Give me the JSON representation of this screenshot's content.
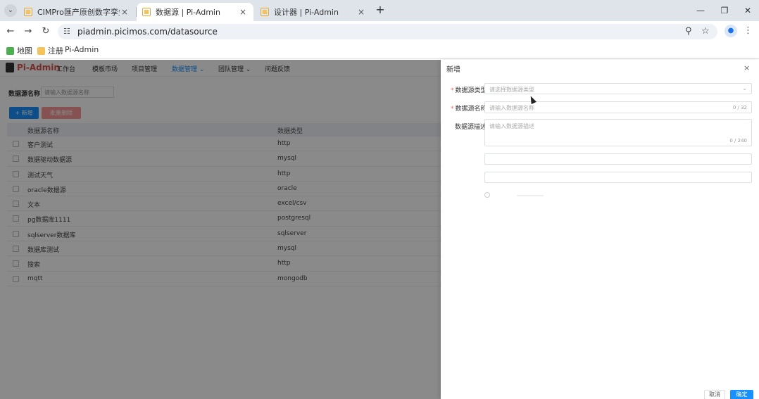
{
  "browser": {
    "tabs": [
      {
        "title": "CIMPro匯产原创数字孪生图形",
        "active": false
      },
      {
        "title": "数据源 | Pi-Admin",
        "active": true
      },
      {
        "title": "设计器 | Pi-Admin",
        "active": false
      }
    ],
    "new_tab": "+",
    "url": "piadmin.picimos.com/datasource",
    "bookmarks": [
      "地图",
      "注册",
      "Pi-Admin"
    ]
  },
  "app": {
    "logo": "Pi-Admin",
    "nav": [
      {
        "label": "工作台",
        "active": false
      },
      {
        "label": "模板市场",
        "active": false
      },
      {
        "label": "项目管理",
        "active": false
      },
      {
        "label": "数据管理 ⌄",
        "active": true
      },
      {
        "label": "团队管理 ⌄",
        "active": false
      },
      {
        "label": "问题反馈",
        "active": false
      }
    ],
    "search": {
      "label": "数据源名称",
      "placeholder": "请输入数据源名称"
    },
    "buttons": {
      "add": "+ 新增",
      "batch_delete": "批量删除"
    },
    "table": {
      "headers": [
        "数据源名称",
        "数据类型"
      ],
      "rows": [
        [
          "客户测试",
          "http"
        ],
        [
          "数据驱动数据源",
          "mysql"
        ],
        [
          "测试天气",
          "http"
        ],
        [
          "oracle数据源",
          "oracle"
        ],
        [
          "文本",
          "excel/csv"
        ],
        [
          "pg数据库1111",
          "postgresql"
        ],
        [
          "sqlserver数据库",
          "sqlserver"
        ],
        [
          "数据库测试",
          "mysql"
        ],
        [
          "搜索",
          "http"
        ],
        [
          "mqtt",
          "mongodb"
        ]
      ]
    }
  },
  "drawer": {
    "title": "新增",
    "close": "×",
    "fields": {
      "type": {
        "label": "数据源类型",
        "placeholder": "请选择数据源类型"
      },
      "name": {
        "label": "数据源名称",
        "placeholder": "请输入数据源名称",
        "count": "0 / 32"
      },
      "desc": {
        "label": "数据源描述",
        "placeholder": "请输入数据源描述",
        "count": "0 / 240"
      }
    },
    "footer": {
      "cancel": "取消",
      "ok": "确定"
    }
  },
  "colors": {
    "primary": "#1890ff",
    "danger": "#f56c6c",
    "mask": "rgba(0,0,0,0.46)"
  }
}
